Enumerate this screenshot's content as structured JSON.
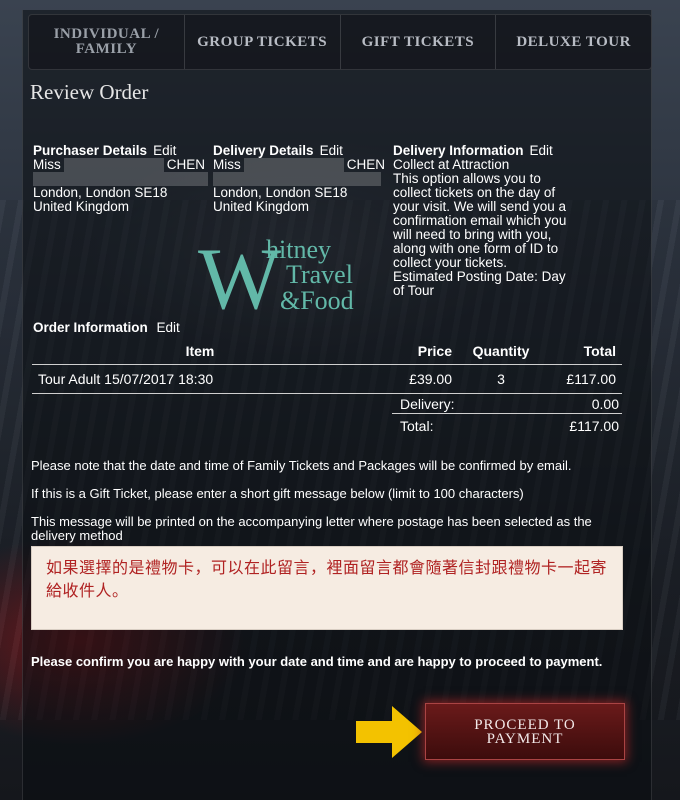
{
  "tabs": [
    {
      "label": "INDIVIDUAL / FAMILY"
    },
    {
      "label": "GROUP TICKETS"
    },
    {
      "label": "GIFT TICKETS"
    },
    {
      "label": "DELUXE TOUR"
    }
  ],
  "page_title": "Review Order",
  "purchaser": {
    "heading": "Purchaser Details",
    "edit": "Edit",
    "salutation": "Miss",
    "surname": "CHEN",
    "address1": "London, London SE18",
    "address2": "United Kingdom"
  },
  "delivery": {
    "heading": "Delivery Details",
    "edit": "Edit",
    "salutation": "Miss",
    "surname": "CHEN",
    "address1": "London, London SE18",
    "address2": "United Kingdom"
  },
  "delivery_info": {
    "heading": "Delivery Information",
    "edit": "Edit",
    "method": "Collect at Attraction",
    "description": "This option allows you to collect tickets on the day of your visit. We will send you a confirmation email which you will need to bring with you, along with one form of ID to collect your tickets.",
    "posting": "Estimated Posting Date: Day of Tour"
  },
  "logo": {
    "text_large": "W",
    "text_hitney": "hitney",
    "text_travel": "Travel",
    "text_amp_food": "&Food",
    "color": "#62b8a8"
  },
  "order": {
    "heading": "Order Information",
    "edit": "Edit",
    "columns": [
      "Item",
      "Price",
      "Quantity",
      "Total"
    ],
    "rows": [
      {
        "item": "Tour Adult 15/07/2017 18:30",
        "price": "£39.00",
        "quantity": "3",
        "total": "£117.00"
      }
    ],
    "delivery_label": "Delivery:",
    "delivery_value": "0.00",
    "total_label": "Total:",
    "total_value": "£117.00"
  },
  "notes": {
    "family": "Please note that the date and time of Family Tickets and Packages will be confirmed by email.",
    "gift": "If this is a Gift Ticket, please enter a short gift message below (limit to 100 characters)",
    "printed": "This message will be printed on the accompanying letter where postage has been selected as the delivery method"
  },
  "gift_message": "如果選擇的是禮物卡，可以在此留言，裡面留言都會隨著信封跟禮物卡一起寄給收件人。",
  "confirm_text": "Please confirm you are happy with your date and time and are happy to proceed to payment.",
  "proceed_button": "PROCEED TO\nPAYMENT",
  "colors": {
    "arrow": "#f3c200",
    "button": "#5a1414",
    "message_text": "#b02222"
  }
}
